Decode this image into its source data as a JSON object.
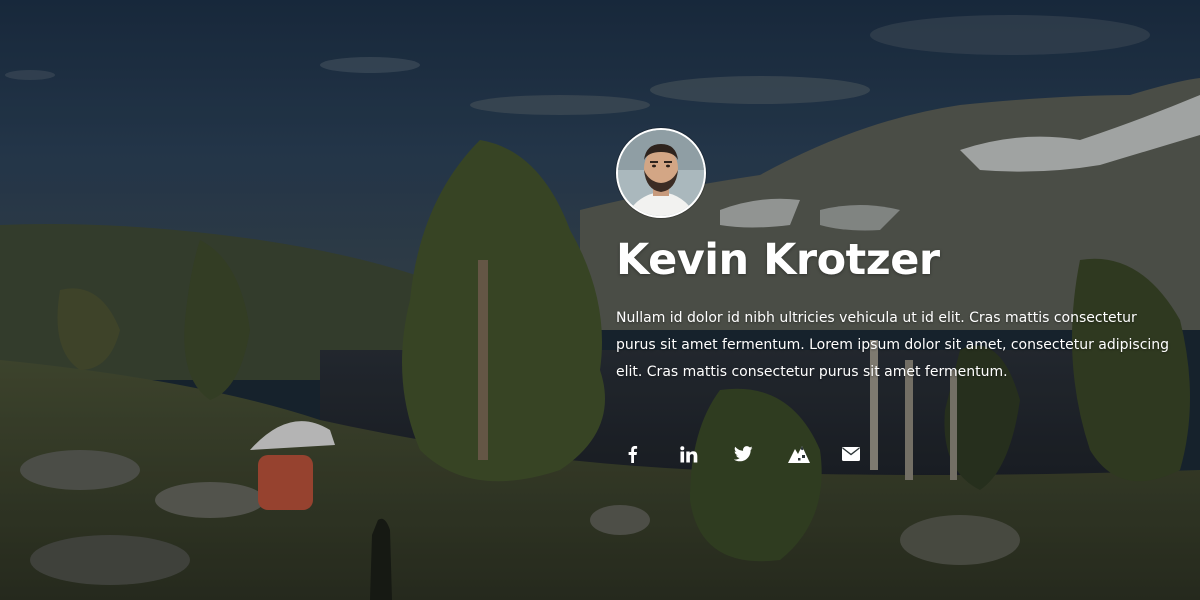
{
  "profile": {
    "name": "Kevin Krotzer",
    "bio": "Nullam id dolor id nibh ultricies vehicula ut id elit. Cras mattis consectetur purus sit amet fermentum. Lorem ipsum dolor sit amet, consectetur adipiscing elit. Cras mattis consectetur purus sit amet fermentum.",
    "avatar_icon": "profile-photo"
  },
  "social_links": [
    {
      "icon": "facebook-icon"
    },
    {
      "icon": "linkedin-icon"
    },
    {
      "icon": "twitter-icon"
    },
    {
      "icon": "mountain-icon"
    },
    {
      "icon": "envelope-icon"
    }
  ],
  "colors": {
    "text": "#ffffff",
    "sky": "#22384f",
    "foliage": "#3e4f2b"
  }
}
